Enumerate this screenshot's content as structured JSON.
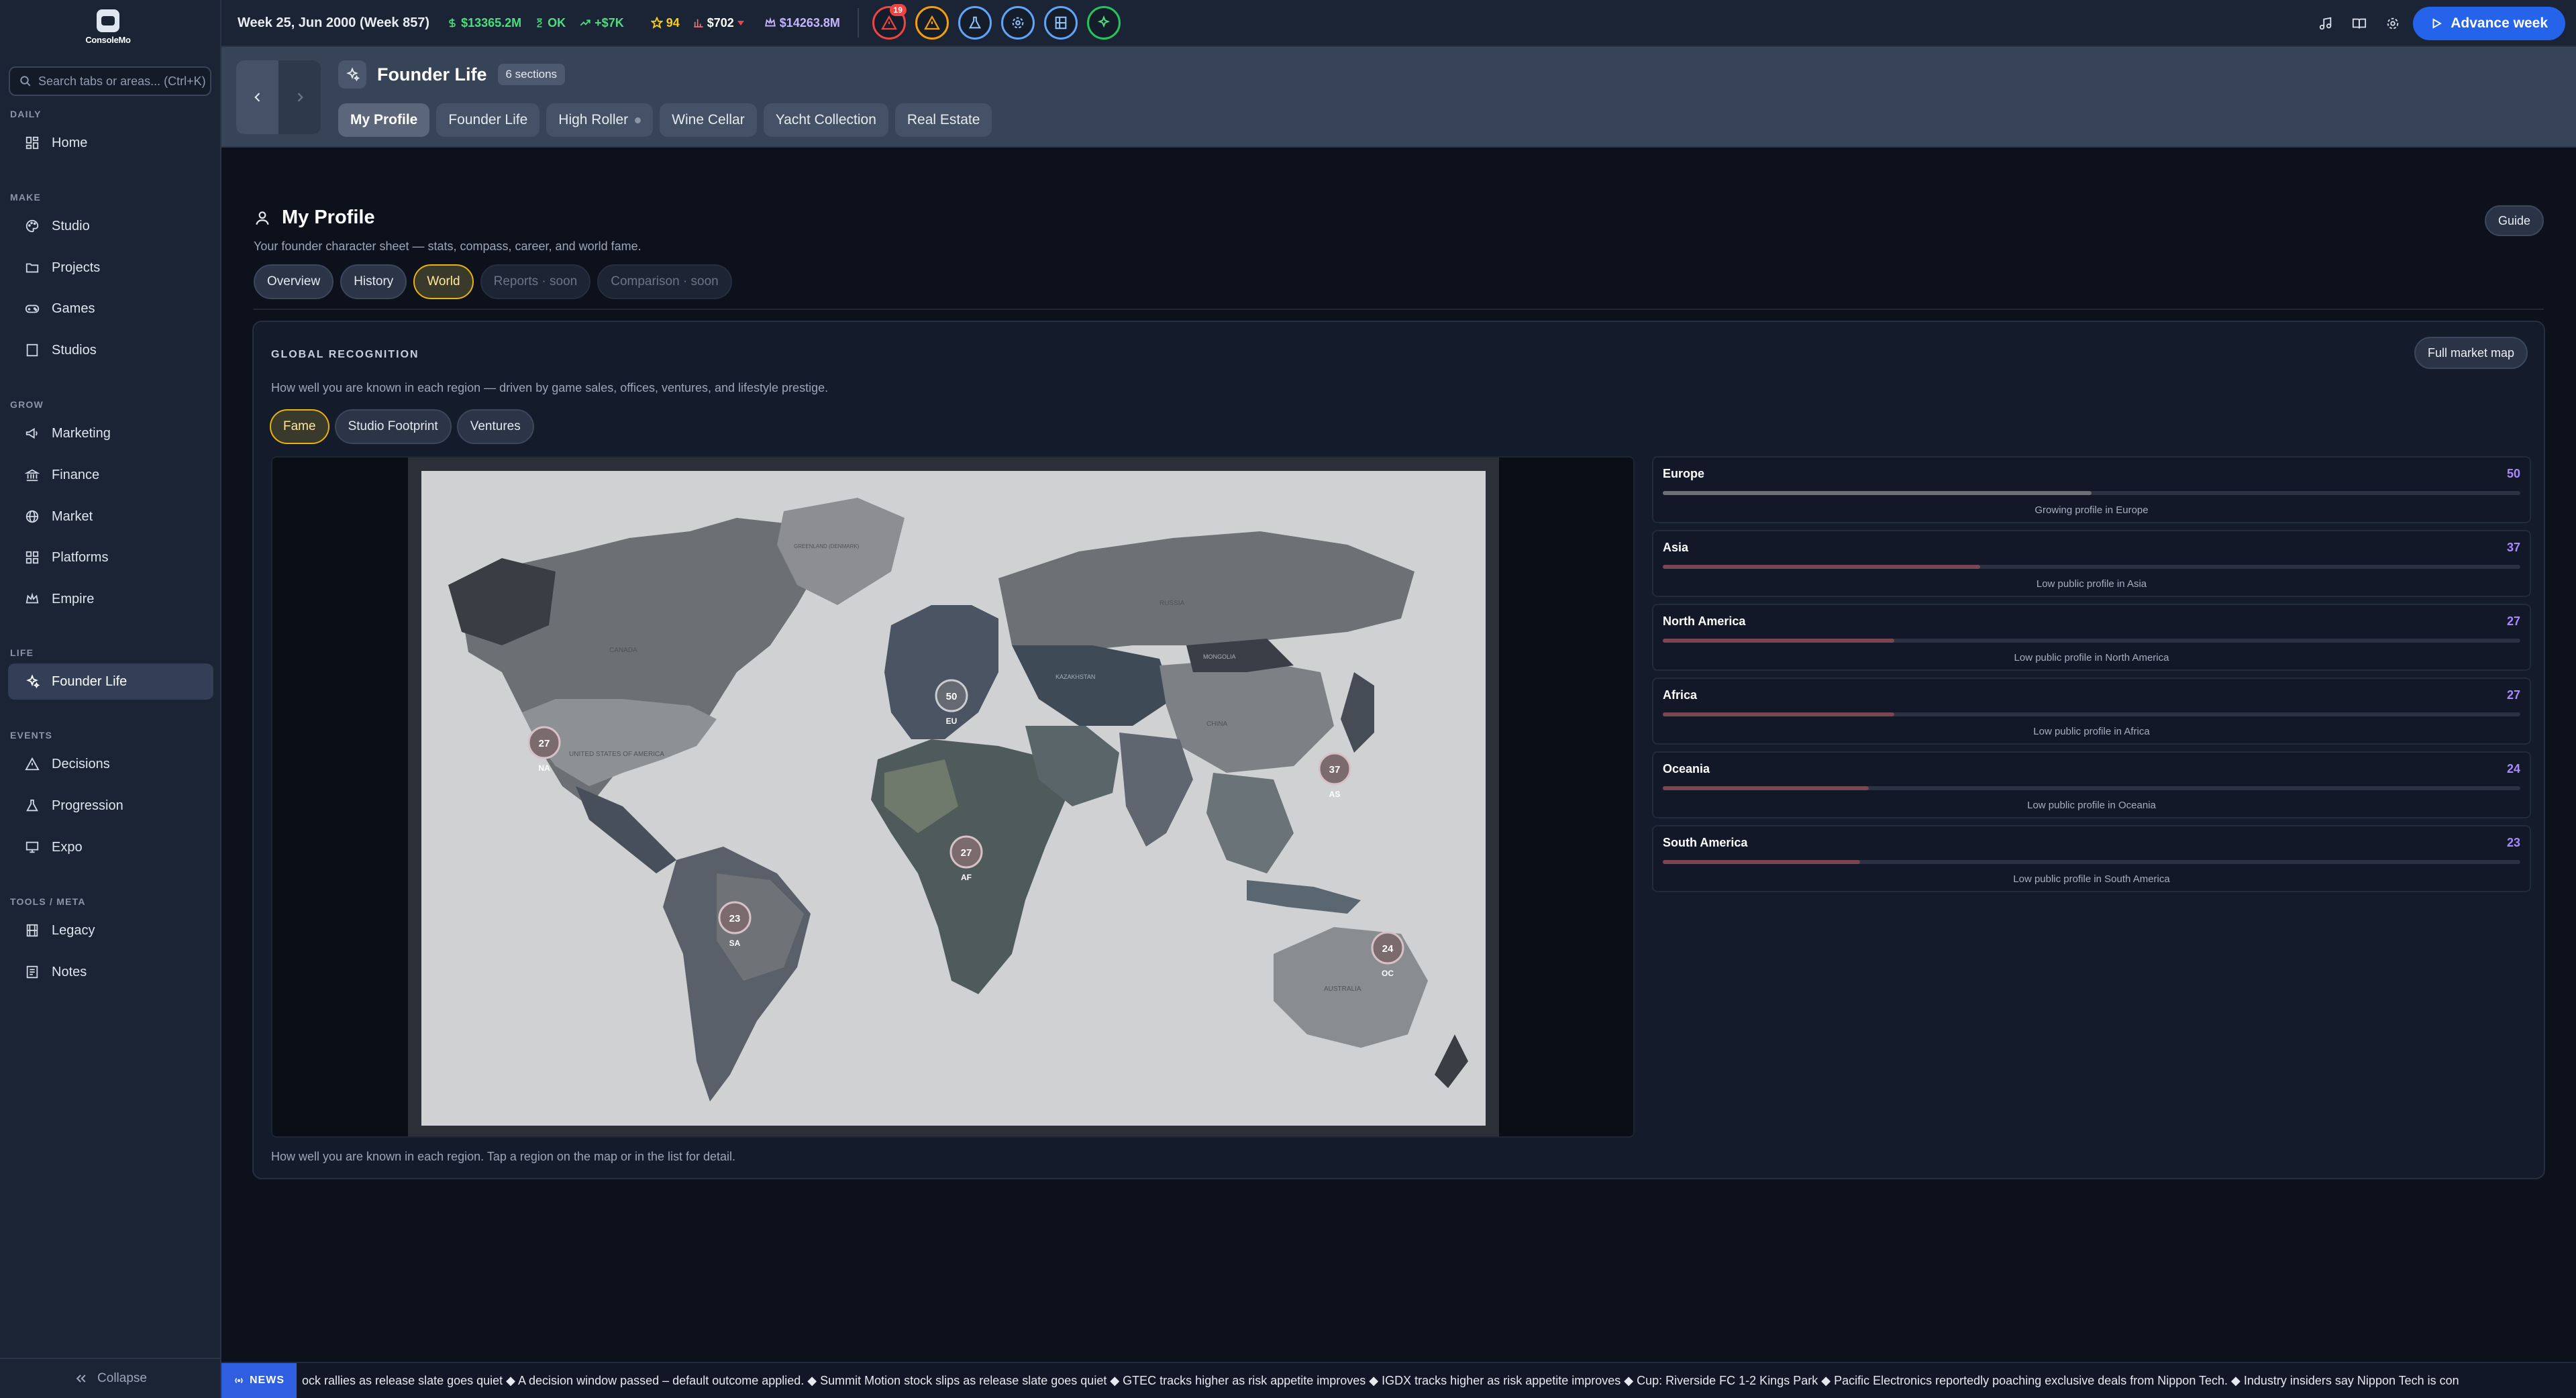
{
  "app": {
    "logo_text": "ConsoleMo"
  },
  "sidebar": {
    "search_placeholder": "Search tabs or areas... (Ctrl+K)",
    "sections": {
      "daily": "DAILY",
      "make": "MAKE",
      "grow": "GROW",
      "life": "LIFE",
      "events": "EVENTS",
      "tools": "TOOLS / META"
    },
    "items": {
      "home": "Home",
      "studio": "Studio",
      "projects": "Projects",
      "games": "Games",
      "studios": "Studios",
      "marketing": "Marketing",
      "finance": "Finance",
      "market": "Market",
      "platforms": "Platforms",
      "empire": "Empire",
      "founder_life": "Founder Life",
      "decisions": "Decisions",
      "progression": "Progression",
      "expo": "Expo",
      "legacy": "Legacy",
      "notes": "Notes"
    },
    "collapse_label": "Collapse"
  },
  "topbar": {
    "week": "Week 25, Jun 2000 (Week 857)",
    "cash": "$13365.2M",
    "runway": "OK",
    "trend": "+$7K",
    "rating": "94",
    "price": "$702",
    "valuation": "$14263.8M",
    "alert_count": "19",
    "advance_label": "Advance week"
  },
  "header": {
    "title": "Founder Life",
    "sections_badge": "6 sections",
    "tabs": [
      "My Profile",
      "Founder Life",
      "High Roller",
      "Wine Cellar",
      "Yacht Collection",
      "Real Estate"
    ]
  },
  "page": {
    "title": "My Profile",
    "subtitle": "Your founder character sheet — stats, compass, career, and world fame.",
    "guide_label": "Guide",
    "tabs": [
      "Overview",
      "History",
      "World",
      "Reports · soon",
      "Comparison · soon"
    ]
  },
  "recognition": {
    "title": "GLOBAL RECOGNITION",
    "full_map_label": "Full market map",
    "description": "How well you are known in each region — driven by game sales, offices, ventures, and lifestyle prestige.",
    "map_tabs": [
      "Fame",
      "Studio Footprint",
      "Ventures"
    ],
    "footer": "How well you are known in each region. Tap a region on the map or in the list for detail.",
    "map_labels": {
      "usa": "UNITED STATES OF AMERICA",
      "russia": "RUSSIA",
      "china": "CHINA",
      "australia": "AUSTRALIA",
      "kazakhstan": "KAZAKHSTAN",
      "mongolia": "MONGOLIA",
      "canada": "CANADA",
      "greenland": "GREENLAND (DENMARK)"
    },
    "pins": [
      {
        "code": "NA",
        "value": "27"
      },
      {
        "code": "EU",
        "value": "50"
      },
      {
        "code": "AS",
        "value": "37"
      },
      {
        "code": "AF",
        "value": "27"
      },
      {
        "code": "SA",
        "value": "23"
      },
      {
        "code": "OC",
        "value": "24"
      }
    ],
    "regions": [
      {
        "name": "Europe",
        "score": "50",
        "pct": 0.5,
        "note": "Growing profile in Europe",
        "color": "#6b6f78"
      },
      {
        "name": "Asia",
        "score": "37",
        "pct": 0.37,
        "note": "Low public profile in Asia",
        "color": "#7a4650"
      },
      {
        "name": "North America",
        "score": "27",
        "pct": 0.27,
        "note": "Low public profile in North America",
        "color": "#7a4650"
      },
      {
        "name": "Africa",
        "score": "27",
        "pct": 0.27,
        "note": "Low public profile in Africa",
        "color": "#7a4650"
      },
      {
        "name": "Oceania",
        "score": "24",
        "pct": 0.24,
        "note": "Low public profile in Oceania",
        "color": "#7a4650"
      },
      {
        "name": "South America",
        "score": "23",
        "pct": 0.23,
        "note": "Low public profile in South America",
        "color": "#7a4650"
      }
    ]
  },
  "news": {
    "badge": "NEWS",
    "text": "ock rallies as release slate goes quiet ◆ A decision window passed – default outcome applied. ◆ Summit Motion stock slips as release slate goes quiet ◆ GTEC tracks higher as risk appetite improves ◆ IGDX tracks higher as risk appetite improves ◆ Cup: Riverside FC 1-2 Kings Park ◆ Pacific Electronics reportedly poaching exclusive deals from Nippon Tech. ◆ Industry insiders say Nippon Tech is con"
  },
  "colors": {
    "accent": "#2563eb",
    "active_tab_border": "#eab308",
    "score": "#a78bfa"
  }
}
